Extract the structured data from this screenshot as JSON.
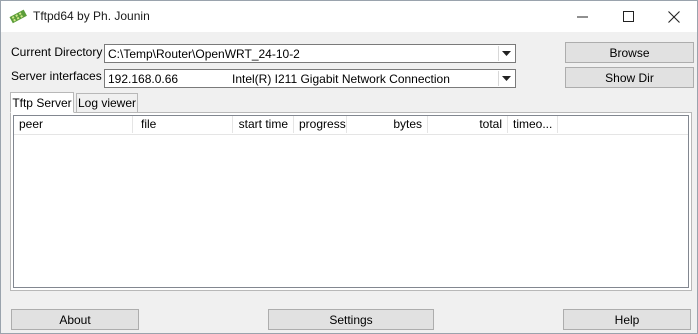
{
  "window": {
    "title": "Tftpd64 by Ph. Jounin",
    "icon": "tftpd-app-icon"
  },
  "controls": {
    "current_directory_label": "Current Directory",
    "current_directory_value": "C:\\Temp\\Router\\OpenWRT_24-10-2",
    "server_interfaces_label": "Server interfaces",
    "server_interfaces_ip": "192.168.0.66",
    "server_interfaces_adapter": "Intel(R) I211 Gigabit Network Connection",
    "browse_label": "Browse",
    "show_dir_label": "Show Dir"
  },
  "tabs": [
    {
      "label": "Tftp Server",
      "active": true
    },
    {
      "label": "Log viewer",
      "active": false
    }
  ],
  "table": {
    "columns": [
      "peer",
      "file",
      "start time",
      "progress",
      "bytes",
      "total",
      "timeo..."
    ]
  },
  "footer": {
    "about_label": "About",
    "settings_label": "Settings",
    "help_label": "Help"
  }
}
